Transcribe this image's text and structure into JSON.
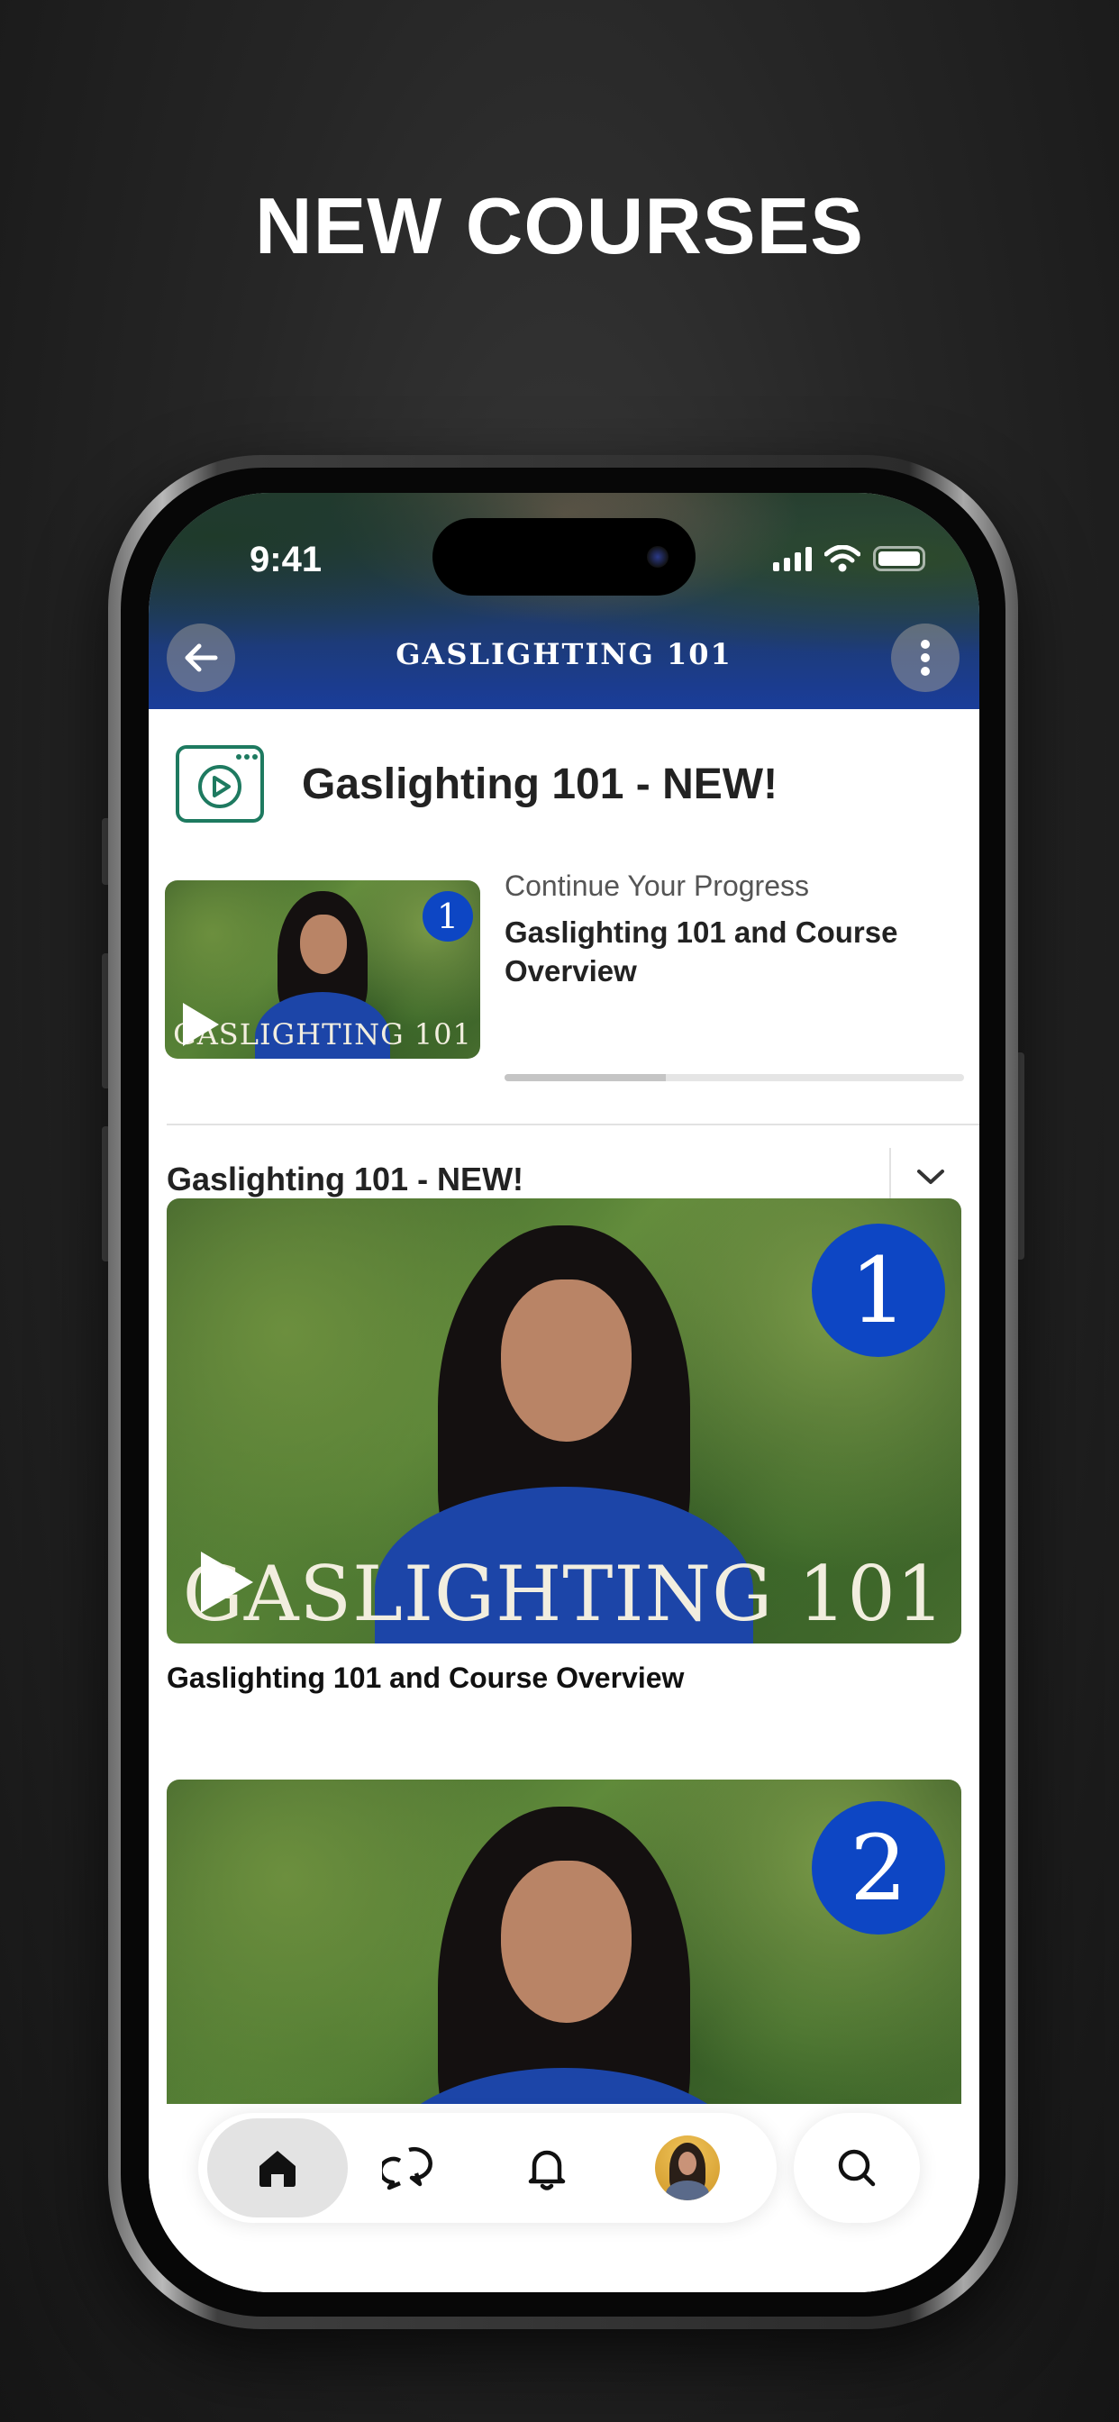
{
  "promo": {
    "headline": "NEW COURSES"
  },
  "status_bar": {
    "time": "9:41"
  },
  "nav": {
    "title": "GASLIGHTING 101",
    "back_icon": "arrow-left-icon",
    "more_icon": "more-vertical-icon"
  },
  "course": {
    "title": "Gaslighting 101 - NEW!",
    "icon": "video-course-icon"
  },
  "continue": {
    "label": "Continue Your Progress",
    "lesson_title": "Gaslighting 101 and Course Overview",
    "progress_fraction": 0.35,
    "thumbnail_badge": "1",
    "thumbnail_caption": "GASLIGHTING 101"
  },
  "section": {
    "title": "Gaslighting 101 - NEW!",
    "toggle_icon": "chevron-down-icon"
  },
  "lessons": [
    {
      "badge": "1",
      "caption": "GASLIGHTING 101",
      "title": "Gaslighting 101 and Course Overview"
    },
    {
      "badge": "2"
    }
  ],
  "tabbar": {
    "items": [
      {
        "name": "home",
        "icon": "home-icon",
        "active": true
      },
      {
        "name": "chats",
        "icon": "chat-bubbles-icon"
      },
      {
        "name": "notifications",
        "icon": "bell-icon"
      },
      {
        "name": "profile",
        "icon": "avatar"
      }
    ],
    "search_icon": "search-icon"
  },
  "colors": {
    "accent_green": "#1e7a60",
    "badge_blue": "#0d46c4",
    "nav_blue": "#1a3d9a"
  }
}
